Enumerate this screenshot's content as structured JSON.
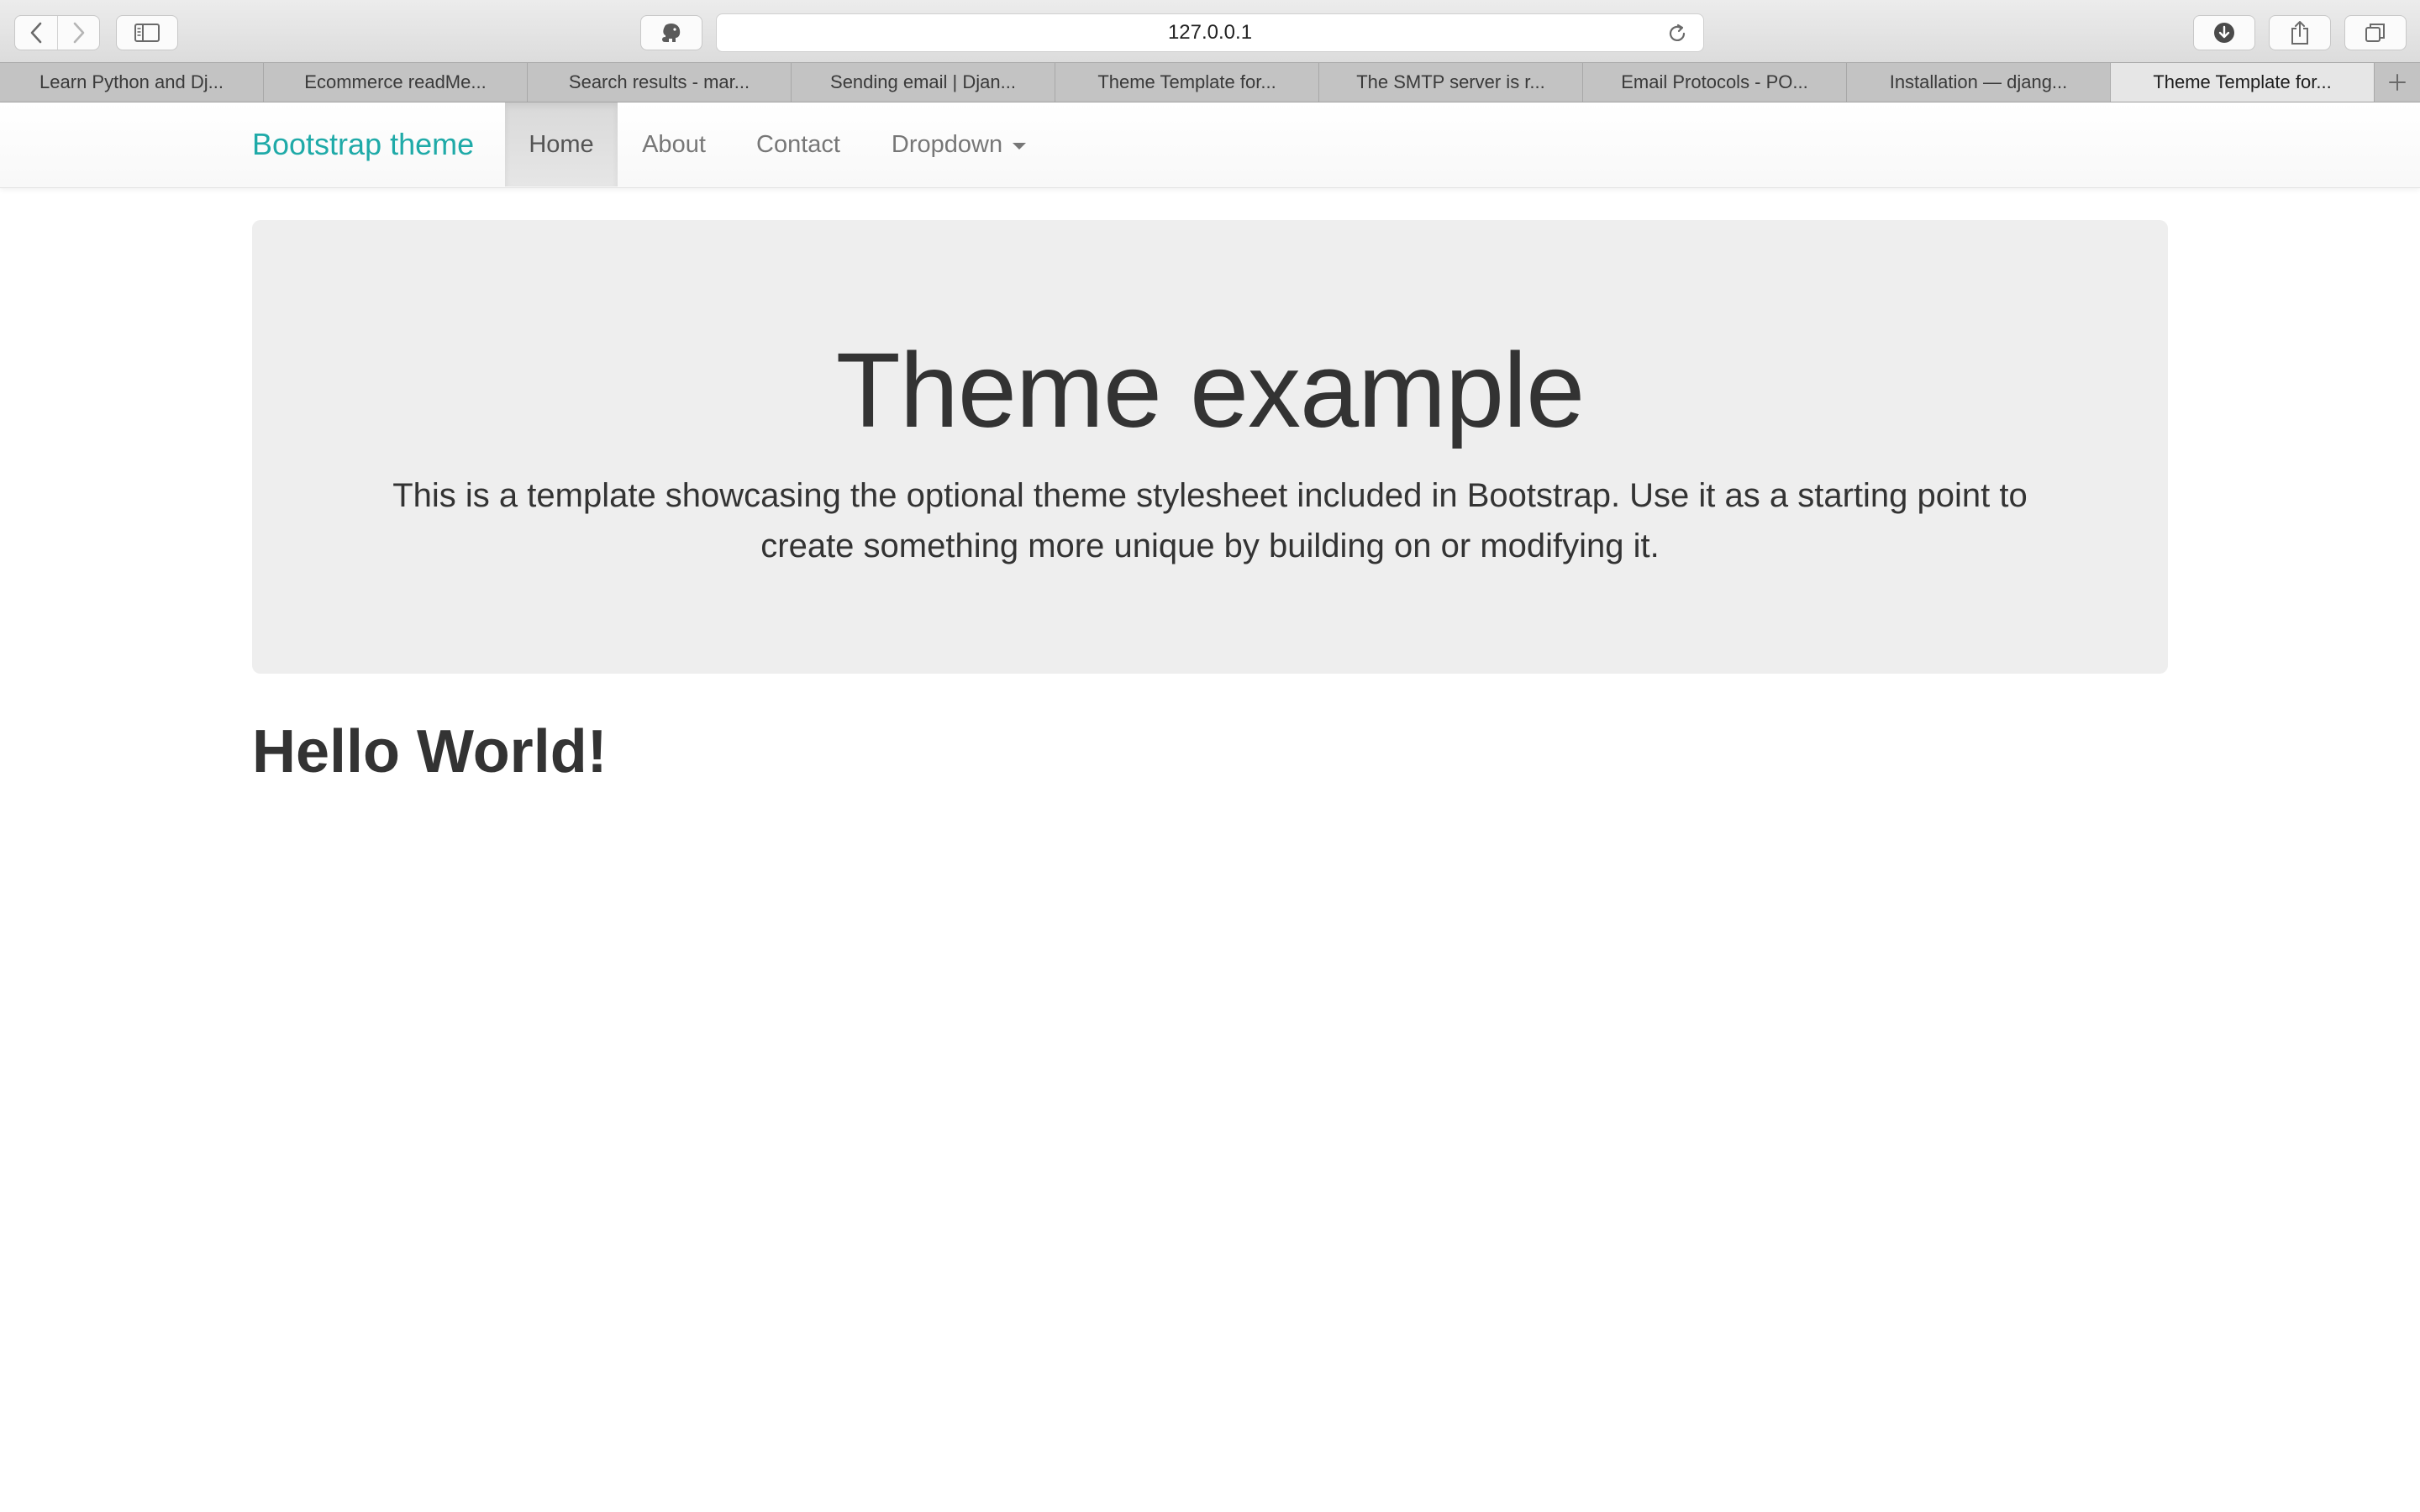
{
  "browser": {
    "address": "127.0.0.1",
    "tabs": [
      {
        "title": "Learn Python and Dj...",
        "active": false
      },
      {
        "title": "Ecommerce readMe...",
        "active": false
      },
      {
        "title": "Search results - mar...",
        "active": false
      },
      {
        "title": "Sending email | Djan...",
        "active": false
      },
      {
        "title": "Theme Template for...",
        "active": false
      },
      {
        "title": "The SMTP server is r...",
        "active": false
      },
      {
        "title": "Email Protocols - PO...",
        "active": false
      },
      {
        "title": "Installation — djang...",
        "active": false
      },
      {
        "title": "Theme Template for...",
        "active": true
      }
    ],
    "icons": {
      "back": "chevron-left-icon",
      "forward": "chevron-right-icon",
      "sidebar": "sidebar-icon",
      "extension": "elephant-icon",
      "reload": "reload-icon",
      "download": "download-icon",
      "share": "share-icon",
      "tabs": "tabs-icon",
      "new_tab": "plus-icon"
    }
  },
  "navbar": {
    "brand": "Bootstrap theme",
    "items": [
      {
        "label": "Home",
        "active": true
      },
      {
        "label": "About",
        "active": false
      },
      {
        "label": "Contact",
        "active": false
      },
      {
        "label": "Dropdown",
        "active": false
      }
    ],
    "brand_color": "#1faaa8"
  },
  "jumbotron": {
    "title": "Theme example",
    "lead": "This is a template showcasing the optional theme stylesheet included in Bootstrap. Use it as a starting point to create something more unique by building on or modifying it."
  },
  "main": {
    "heading": "Hello World!"
  }
}
